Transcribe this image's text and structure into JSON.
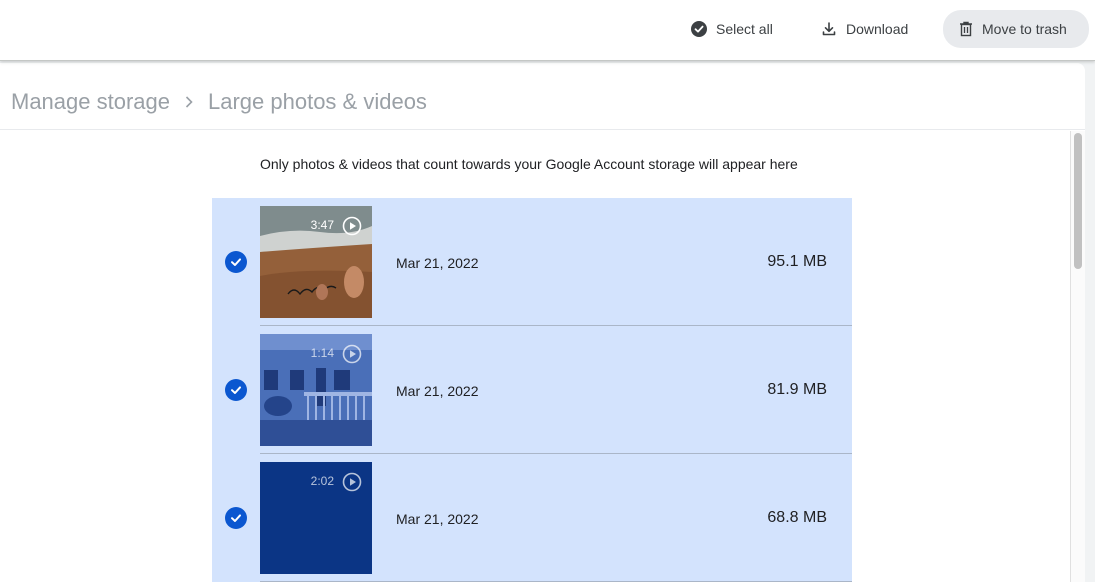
{
  "toolbar": {
    "select_all_label": "Select all",
    "download_label": "Download",
    "trash_label": "Move to trash"
  },
  "breadcrumb": {
    "parent": "Manage storage",
    "current": "Large photos & videos"
  },
  "notice": "Only photos & videos that count towards your Google Account storage will appear here",
  "items": [
    {
      "duration": "3:47",
      "date": "Mar 21, 2022",
      "size": "95.1 MB",
      "selected": true,
      "thumbnail": "video-desk-photo"
    },
    {
      "duration": "1:14",
      "date": "Mar 21, 2022",
      "size": "81.9 MB",
      "selected": true,
      "thumbnail": "video-house-porch"
    },
    {
      "duration": "2:02",
      "date": "Mar 21, 2022",
      "size": "68.8 MB",
      "selected": true,
      "thumbnail": "video-dark-blue"
    }
  ],
  "colors": {
    "selected_row": "#d3e3fd",
    "check_blue": "#0b57d0",
    "trash_button": "#e8eaed"
  }
}
